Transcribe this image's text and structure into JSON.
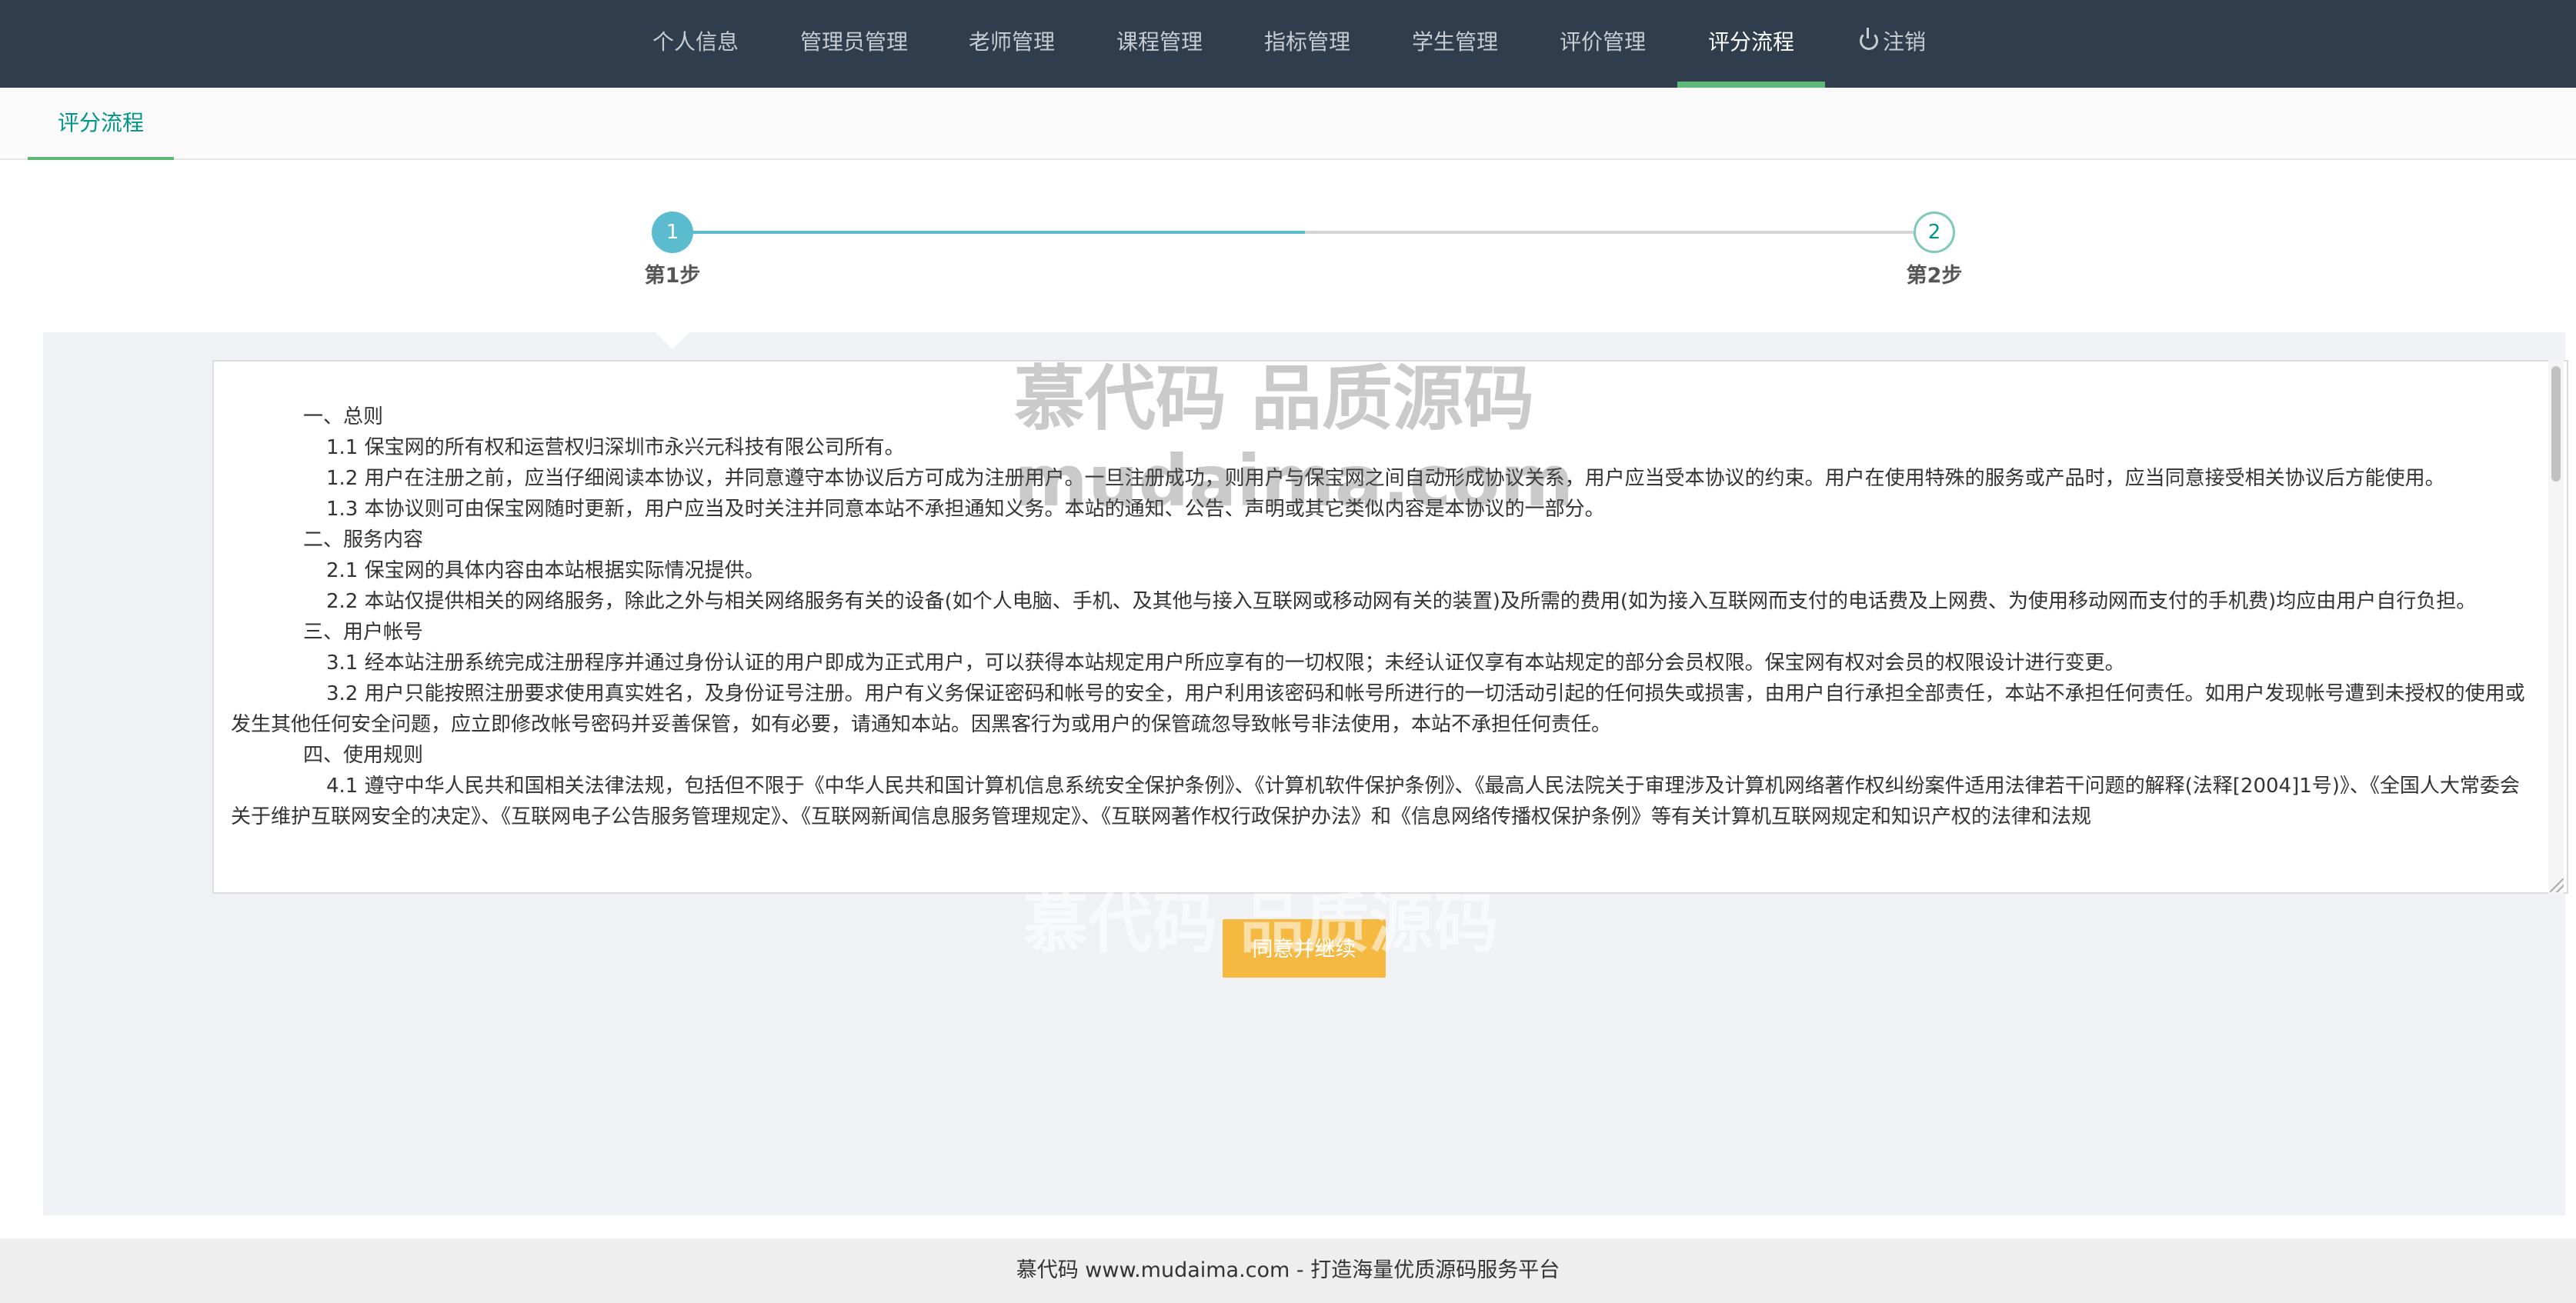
{
  "nav": {
    "items": [
      {
        "label": "个人信息"
      },
      {
        "label": "管理员管理"
      },
      {
        "label": "老师管理"
      },
      {
        "label": "课程管理"
      },
      {
        "label": "指标管理"
      },
      {
        "label": "学生管理"
      },
      {
        "label": "评价管理"
      },
      {
        "label": "评分流程"
      },
      {
        "label": "注销"
      }
    ],
    "active_index": 7,
    "logout_icon": "power-icon"
  },
  "tab": {
    "label": "评分流程"
  },
  "steps": [
    {
      "number": "1",
      "label": "第1步"
    },
    {
      "number": "2",
      "label": "第2步"
    }
  ],
  "agreement": {
    "lines": [
      "一、总则",
      "1.1 保宝网的所有权和运营权归深圳市永兴元科技有限公司所有。",
      "1.2 用户在注册之前，应当仔细阅读本协议，并同意遵守本协议后方可成为注册用户。一旦注册成功，则用户与保宝网之间自动形成协议关系，用户应当受本协议的约束。用户在使用特殊的服务或产品时，应当同意接受相关协议后方能使用。",
      "1.3 本协议则可由保宝网随时更新，用户应当及时关注并同意本站不承担通知义务。本站的通知、公告、声明或其它类似内容是本协议的一部分。",
      "二、服务内容",
      "2.1 保宝网的具体内容由本站根据实际情况提供。",
      "2.2 本站仅提供相关的网络服务，除此之外与相关网络服务有关的设备(如个人电脑、手机、及其他与接入互联网或移动网有关的装置)及所需的费用(如为接入互联网而支付的电话费及上网费、为使用移动网而支付的手机费)均应由用户自行负担。",
      "三、用户帐号",
      "3.1 经本站注册系统完成注册程序并通过身份认证的用户即成为正式用户，可以获得本站规定用户所应享有的一切权限；未经认证仅享有本站规定的部分会员权限。保宝网有权对会员的权限设计进行变更。",
      "3.2 用户只能按照注册要求使用真实姓名，及身份证号注册。用户有义务保证密码和帐号的安全，用户利用该密码和帐号所进行的一切活动引起的任何损失或损害，由用户自行承担全部责任，本站不承担任何责任。如用户发现帐号遭到未授权的使用或发生其他任何安全问题，应立即修改帐号密码并妥善保管，如有必要，请通知本站。因黑客行为或用户的保管疏忽导致帐号非法使用，本站不承担任何责任。",
      "四、使用规则",
      "4.1 遵守中华人民共和国相关法律法规，包括但不限于《中华人民共和国计算机信息系统安全保护条例》、《计算机软件保护条例》、《最高人民法院关于审理涉及计算机网络著作权纠纷案件适用法律若干问题的解释(法释[2004]1号)》、《全国人大常委会关于维护互联网安全的决定》、《互联网电子公告服务管理规定》、《互联网新闻信息服务管理规定》、《互联网著作权行政保护办法》和《信息网络传播权保护条例》等有关计算机互联网规定和知识产权的法律和法规"
    ]
  },
  "agree_button": {
    "label": "同意并继续"
  },
  "watermark": {
    "line1": "慕代码 品质源码",
    "line2": "mudaima.com",
    "line3": "慕代码 品质源码"
  },
  "footer": {
    "text": "慕代码 www.mudaima.com - 打造海量优质源码服务平台"
  },
  "colors": {
    "nav_bg": "#2f3d4c",
    "accent_green": "#5fb878",
    "step_active": "#5bbcd0",
    "button": "#f5b942"
  }
}
